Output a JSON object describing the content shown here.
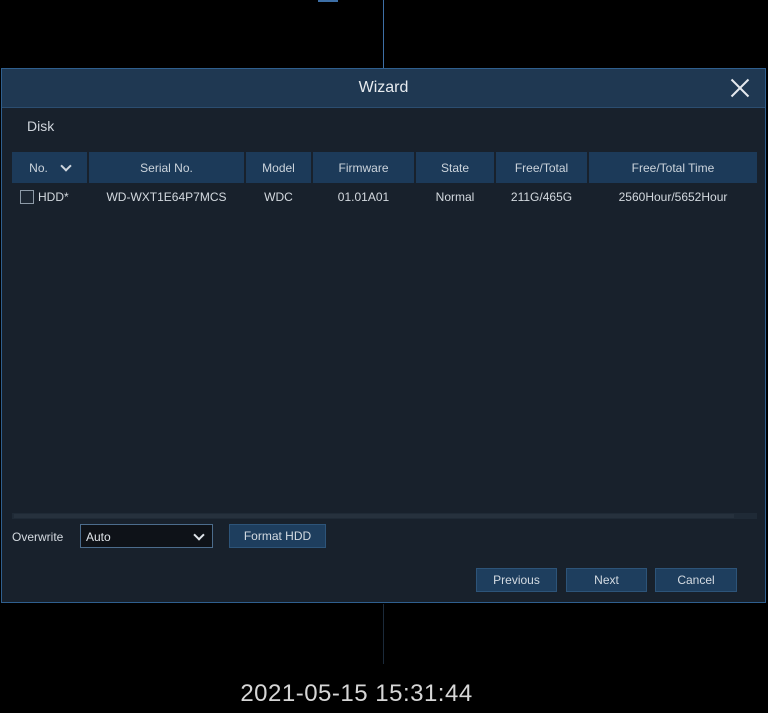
{
  "dialog": {
    "title": "Wizard",
    "section": "Disk"
  },
  "table": {
    "headers": [
      "No.",
      "Serial No.",
      "Model",
      "Firmware",
      "State",
      "Free/Total",
      "Free/Total Time"
    ],
    "rows": [
      {
        "no": "HDD*",
        "serial": "WD-WXT1E64P7MCS",
        "model": "WDC",
        "firmware": "01.01A01",
        "state": "Normal",
        "free_total": "211G/465G",
        "free_total_time": "2560Hour/5652Hour",
        "checked": false
      }
    ]
  },
  "overwrite": {
    "label": "Overwrite",
    "value": "Auto"
  },
  "buttons": {
    "format": "Format HDD",
    "previous": "Previous",
    "next": "Next",
    "cancel": "Cancel"
  },
  "timestamp": "2021-05-15 15:31:44",
  "colors": {
    "dialog_bg": "#18212c",
    "header_bg": "#1c3a59",
    "button_bg": "#1e3e5e",
    "accent_line": "#3d6fa6"
  }
}
